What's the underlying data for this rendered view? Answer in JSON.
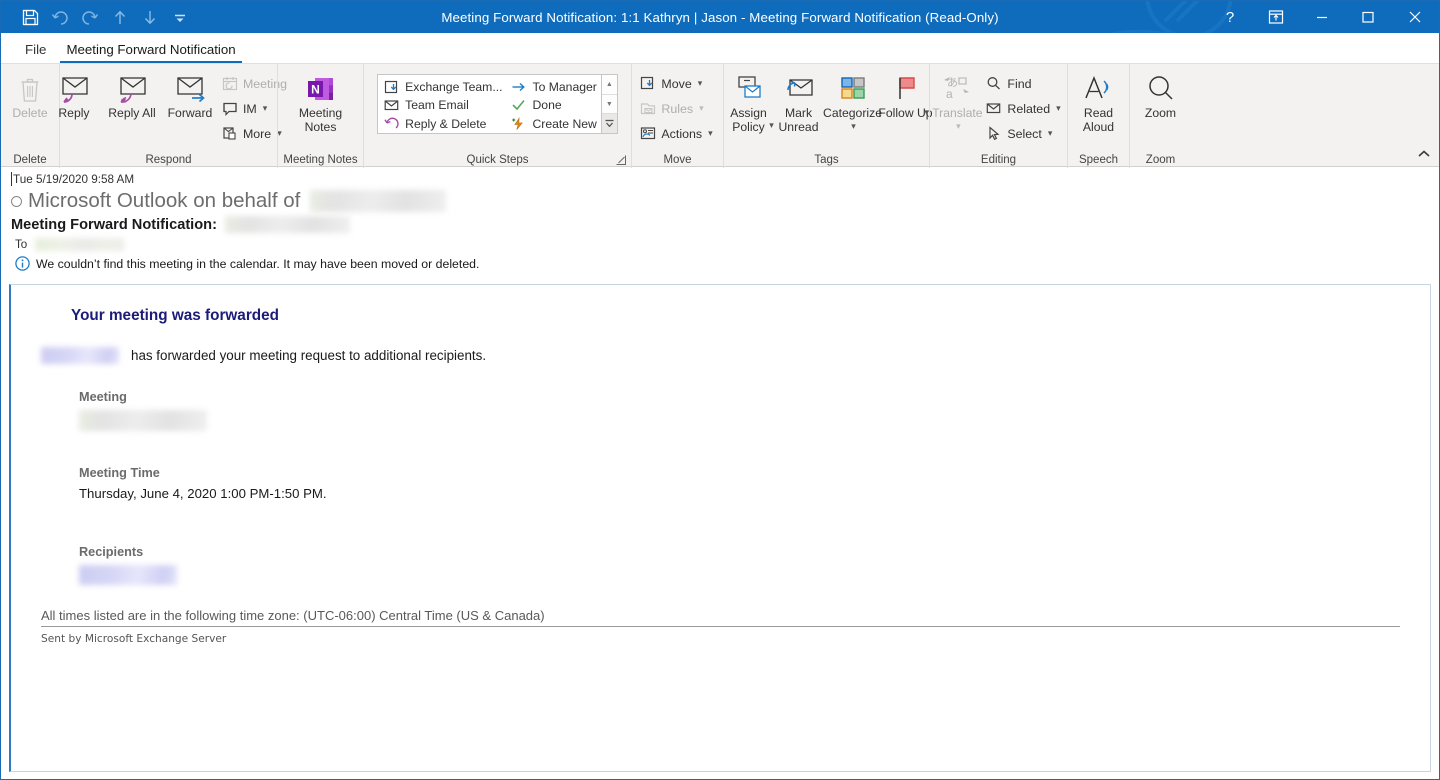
{
  "titlebar": {
    "title": "Meeting Forward Notification: 1:1 Kathryn | Jason   -  Meeting Forward Notification  (Read-Only)",
    "quick_access": [
      {
        "name": "save-icon",
        "label": "Save"
      },
      {
        "name": "undo-icon",
        "label": "Undo"
      },
      {
        "name": "redo-icon",
        "label": "Redo"
      },
      {
        "name": "previous-item-icon",
        "label": "Previous Item"
      },
      {
        "name": "next-item-icon",
        "label": "Next Item"
      },
      {
        "name": "customize-quick-access-toolbar-icon",
        "label": "Customize Quick Access Toolbar"
      }
    ],
    "controls": [
      {
        "name": "help-button",
        "label": "?"
      },
      {
        "name": "ribbon-display-options-button",
        "label": "Ribbon Display Options"
      },
      {
        "name": "minimize-button",
        "label": "Minimize"
      },
      {
        "name": "maximize-button",
        "label": "Maximize"
      },
      {
        "name": "close-button",
        "label": "Close"
      }
    ],
    "accent_color": "#0f6cbd"
  },
  "tabs": [
    {
      "label": "File",
      "active": false
    },
    {
      "label": "Meeting Forward Notification",
      "active": true
    }
  ],
  "ribbon": {
    "collapse_label": "⌃",
    "groups": [
      {
        "name": "Delete",
        "buttons": [
          {
            "label": "Delete",
            "icon": "trash-icon",
            "disabled": true
          }
        ]
      },
      {
        "name": "Respond",
        "buttons": [
          {
            "label": "Reply",
            "icon": "reply-icon",
            "disabled": false
          },
          {
            "label": "Reply All",
            "icon": "reply-all-icon",
            "disabled": false
          },
          {
            "label": "Forward",
            "icon": "forward-icon",
            "disabled": false
          }
        ],
        "small_buttons": [
          {
            "label": "Meeting",
            "icon": "meeting-icon",
            "disabled": true,
            "chevron": false
          },
          {
            "label": "IM",
            "icon": "im-icon",
            "disabled": false,
            "chevron": true
          },
          {
            "label": "More",
            "icon": "more-icon",
            "disabled": false,
            "chevron": true
          }
        ]
      },
      {
        "name": "Meeting Notes",
        "buttons": [
          {
            "label": "Meeting Notes",
            "icon": "onenote-icon",
            "disabled": false
          }
        ]
      },
      {
        "name": "Quick Steps",
        "items": [
          {
            "label": "Exchange Team...",
            "icon": "move-to-folder-icon"
          },
          {
            "label": "To Manager",
            "icon": "forward-arrow-icon"
          },
          {
            "label": "Team Email",
            "icon": "envelope-icon"
          },
          {
            "label": "Done",
            "icon": "checkmark-icon"
          },
          {
            "label": "Reply & Delete",
            "icon": "reply-delete-icon"
          },
          {
            "label": "Create New",
            "icon": "create-new-icon"
          }
        ],
        "scroll": [
          "▲",
          "▼",
          "▼"
        ],
        "dialog_launcher": "quick-steps-dialog-launcher"
      },
      {
        "name": "Move",
        "small_buttons": [
          {
            "label": "Move",
            "icon": "move-icon",
            "disabled": false,
            "chevron": true
          },
          {
            "label": "Rules",
            "icon": "rules-icon",
            "disabled": true,
            "chevron": true
          },
          {
            "label": "Actions",
            "icon": "actions-icon",
            "disabled": false,
            "chevron": true
          }
        ]
      },
      {
        "name": "Tags",
        "buttons": [
          {
            "label": "Assign Policy",
            "icon": "assign-policy-icon",
            "disabled": false,
            "chevron": true
          },
          {
            "label": "Mark Unread",
            "icon": "mark-unread-icon",
            "disabled": false,
            "chevron": false
          },
          {
            "label": "Categorize",
            "icon": "categorize-icon",
            "disabled": false,
            "chevron": true
          },
          {
            "label": "Follow Up",
            "icon": "follow-up-flag-icon",
            "disabled": false,
            "chevron": true
          }
        ]
      },
      {
        "name": "Editing",
        "buttons": [
          {
            "label": "Translate",
            "icon": "translate-icon",
            "disabled": true,
            "chevron": true
          }
        ],
        "small_buttons": [
          {
            "label": "Find",
            "icon": "find-icon",
            "disabled": false,
            "chevron": false
          },
          {
            "label": "Related",
            "icon": "related-icon",
            "disabled": false,
            "chevron": true
          },
          {
            "label": "Select",
            "icon": "select-icon",
            "disabled": false,
            "chevron": true
          }
        ]
      },
      {
        "name": "Speech",
        "buttons": [
          {
            "label": "Read Aloud",
            "icon": "read-aloud-icon",
            "disabled": false
          }
        ]
      },
      {
        "name": "Zoom",
        "buttons": [
          {
            "label": "Zoom",
            "icon": "zoom-magnifier-icon",
            "disabled": false
          }
        ]
      }
    ]
  },
  "message": {
    "sent_date": "Tue 5/19/2020 9:58 AM",
    "from_prefix": "Microsoft Outlook on behalf of",
    "from_redacted": true,
    "subject_label": "Meeting Forward Notification:",
    "subject_redacted": true,
    "to_label": "To",
    "to_redacted": true,
    "info_icon": "info-icon",
    "info_text": "We couldn’t find this meeting in the calendar. It may have been moved or deleted."
  },
  "body": {
    "heading": "Your meeting was forwarded",
    "heading_color": "#1b1b7a",
    "sentence_suffix": "has forwarded your meeting request to additional recipients.",
    "meeting_label": "Meeting",
    "meeting_value_redacted": true,
    "meeting_time_label": "Meeting Time",
    "meeting_time_value": "Thursday, June 4, 2020 1:00 PM-1:50 PM.",
    "recipients_label": "Recipients",
    "recipients_value_redacted": true,
    "timezone_note": "All times listed are in the following time zone: (UTC-06:00) Central Time (US & Canada)",
    "footer": "Sent by Microsoft Exchange Server"
  }
}
